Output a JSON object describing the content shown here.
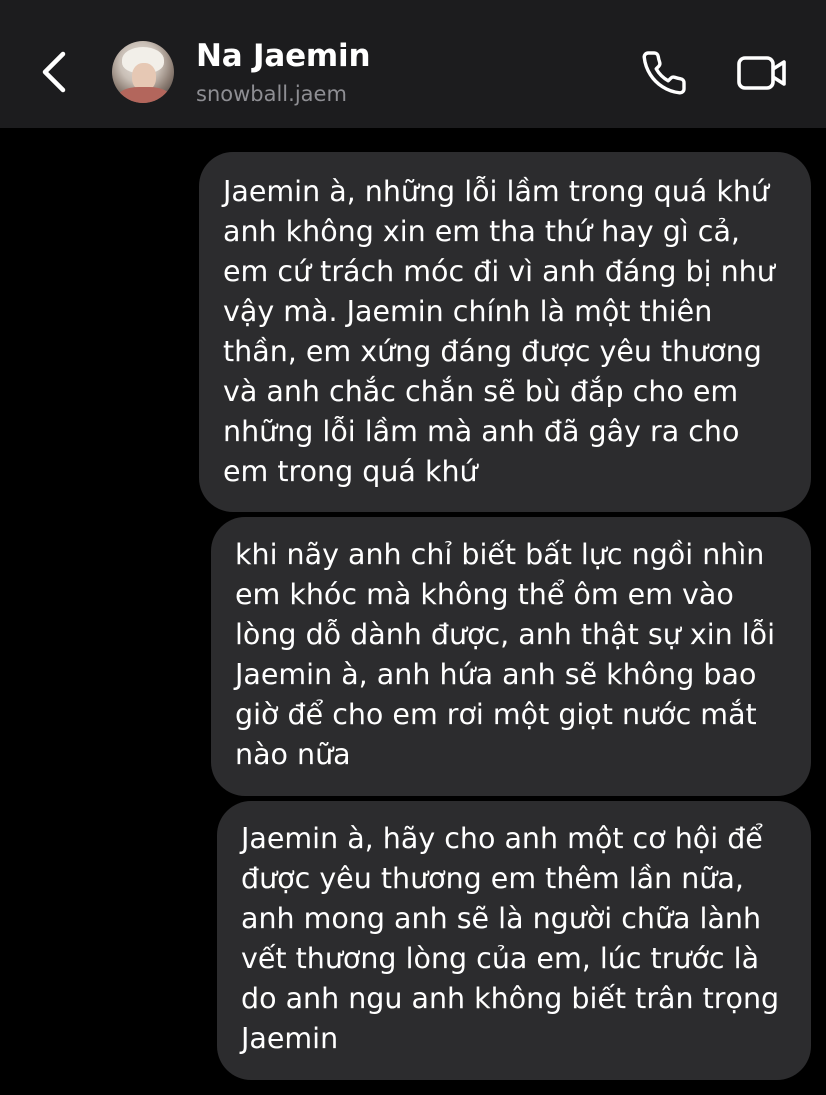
{
  "header": {
    "back_icon": "chevron-left-icon",
    "contact_name": "Na Jaemin",
    "contact_handle": "snowball.jaem",
    "call_icon": "phone-icon",
    "video_icon": "video-camera-icon"
  },
  "messages": [
    {
      "lines": [
        "Jaemin à, những lỗi lầm trong quá khứ",
        "anh không xin em tha thứ hay gì cả,",
        "em cứ trách móc đi vì anh đáng bị như",
        "vậy mà. Jaemin chính là một thiên",
        "thần, em xứng đáng được yêu thương",
        "và anh chắc chắn sẽ bù đắp cho em",
        "những lỗi lầm mà anh đã gây ra cho",
        "em trong quá khứ"
      ]
    },
    {
      "lines": [
        "khi nãy anh chỉ biết bất lực ngồi nhìn",
        "em khóc mà không thể ôm em vào",
        "lòng dỗ dành được, anh thật sự xin lỗi",
        "Jaemin à, anh hứa anh sẽ không bao",
        "giờ để cho em rơi một giọt nước mắt",
        "nào nữa"
      ]
    },
    {
      "lines": [
        "Jaemin à, hãy cho anh một cơ hội để",
        "được yêu thương em thêm lần nữa,",
        "anh mong anh sẽ là người chữa lành",
        "vết thương lòng của em, lúc trước là",
        "do anh ngu anh không biết trân trọng",
        "Jaemin"
      ]
    }
  ],
  "colors": {
    "background": "#000000",
    "header_background": "#1c1c1e",
    "bubble": "#2c2c2e",
    "text": "#ffffff",
    "secondary_text": "#8e8e93"
  }
}
